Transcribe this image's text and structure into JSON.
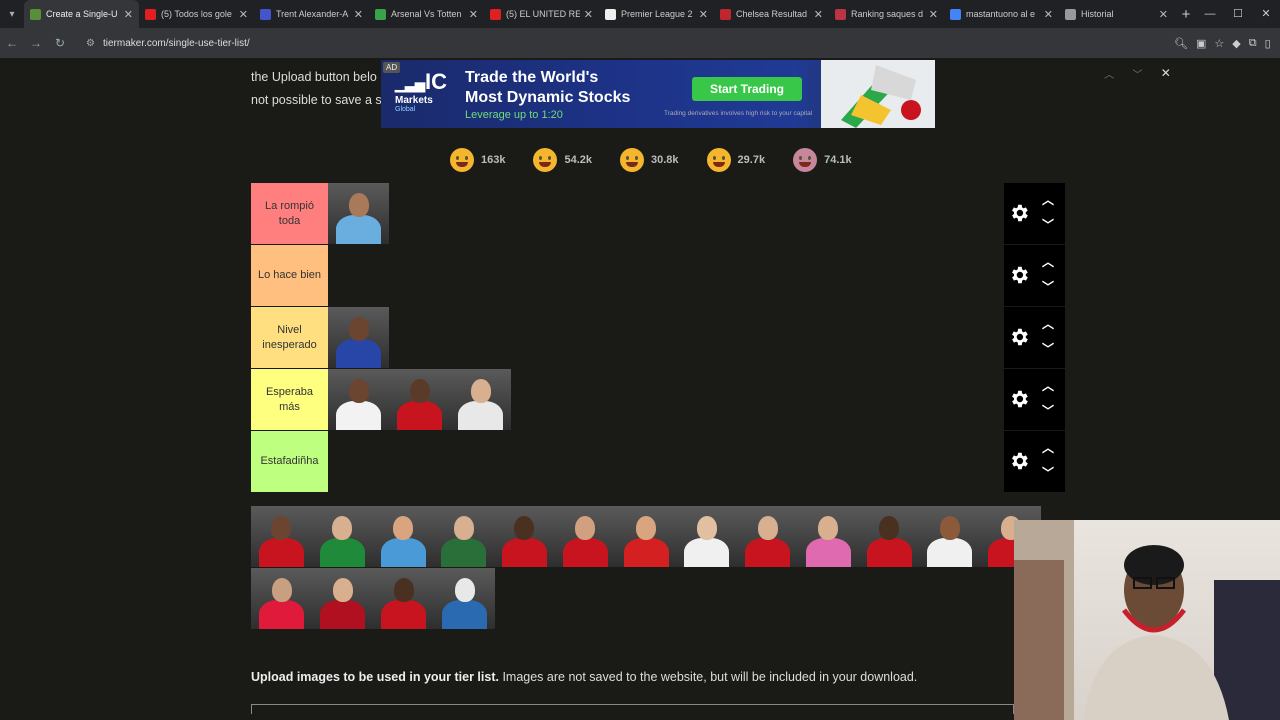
{
  "browser": {
    "tabs": [
      {
        "title": "Create a Single-U",
        "color": "#5a8f3a",
        "active": true
      },
      {
        "title": "(5) Todos los gole",
        "color": "#e02020"
      },
      {
        "title": "Trent Alexander-A",
        "color": "#4455cc"
      },
      {
        "title": "Arsenal Vs Totten",
        "color": "#3aa34a"
      },
      {
        "title": "(5) EL UNITED RE",
        "color": "#e02020"
      },
      {
        "title": "Premier League 2",
        "color": "#eeeeee"
      },
      {
        "title": "Chelsea Resultad",
        "color": "#c0272d"
      },
      {
        "title": "Ranking saques d",
        "color": "#bb3344"
      },
      {
        "title": "mastantuono al e",
        "color": "#4285f4"
      },
      {
        "title": "Historial",
        "color": "#999999"
      }
    ],
    "url": "tiermaker.com/single-use-tier-list/"
  },
  "intro": {
    "line1": "the Upload button belo",
    "line2": "not possible to save a s"
  },
  "ad": {
    "tag": "AD",
    "brand": "IC",
    "brand2": "Markets",
    "brand3": "Global",
    "headline1": "Trade the World's",
    "headline2": "Most Dynamic Stocks",
    "leverage": "Leverage up to 1:20",
    "cta": "Start Trading",
    "fine_print": "Trading derivatives involves high risk to your capital"
  },
  "reactions": [
    {
      "icon": "grinning-face-icon",
      "count": "163k",
      "color": "#f5b52d"
    },
    {
      "icon": "heart-eyes-face-icon",
      "count": "54.2k",
      "color": "#f5b52d"
    },
    {
      "icon": "laughing-face-icon",
      "count": "30.8k",
      "color": "#f5b52d"
    },
    {
      "icon": "raised-hands-icon",
      "count": "29.7k",
      "color": "#f5b52d"
    },
    {
      "icon": "poop-icon",
      "count": "74.1k",
      "color": "#c7869b"
    }
  ],
  "tiers": [
    {
      "label": "La rompió toda",
      "color": "#ff7f7f",
      "players": [
        {
          "kit": "#6aaee0",
          "skin": "#a87a5a"
        }
      ]
    },
    {
      "label": "Lo hace bien",
      "color": "#ffbf7f",
      "players": []
    },
    {
      "label": "Nivel inesperado",
      "color": "#ffdf7f",
      "players": [
        {
          "kit": "#2845a8",
          "skin": "#6b4530"
        }
      ]
    },
    {
      "label": "Esperaba más",
      "color": "#ffff7f",
      "players": [
        {
          "kit": "#f2f2f2",
          "skin": "#6b4530"
        },
        {
          "kit": "#c8141e",
          "skin": "#5a3a28"
        },
        {
          "kit": "#e8e8e8",
          "skin": "#d8b090"
        }
      ]
    },
    {
      "label": "Estafadiñha",
      "color": "#bfff7f",
      "players": []
    }
  ],
  "pool": {
    "row1": [
      {
        "kit": "#c8141e",
        "skin": "#6b4530"
      },
      {
        "kit": "#1f8a3a",
        "skin": "#d8b090"
      },
      {
        "kit": "#4a9ad8",
        "skin": "#d8a580"
      },
      {
        "kit": "#2a6e3a",
        "skin": "#d8b090"
      },
      {
        "kit": "#c8141e",
        "skin": "#4a3020"
      },
      {
        "kit": "#c8141e",
        "skin": "#d0a080"
      },
      {
        "kit": "#d42020",
        "skin": "#d8a580"
      },
      {
        "kit": "#f0f0f0",
        "skin": "#e0c0a0"
      },
      {
        "kit": "#c8141e",
        "skin": "#d8b090"
      },
      {
        "kit": "#e06ab0",
        "skin": "#d8b090"
      },
      {
        "kit": "#c8141e",
        "skin": "#4a3020"
      },
      {
        "kit": "#f0f0f0",
        "skin": "#8a5a3a"
      },
      {
        "kit": "#c8141e",
        "skin": "#d8b090"
      }
    ],
    "row2": [
      {
        "kit": "#e01a3a",
        "skin": "#c8a080"
      },
      {
        "kit": "#b01020",
        "skin": "#d8b090"
      },
      {
        "kit": "#c8141e",
        "skin": "#4a3020"
      },
      {
        "kit": "#2a6ab0",
        "skin": "#e8e8e8"
      }
    ]
  },
  "upload": {
    "bold": "Upload images to be used in your tier list.",
    "rest": " Images are not saved to the website, but will be included in your download."
  }
}
